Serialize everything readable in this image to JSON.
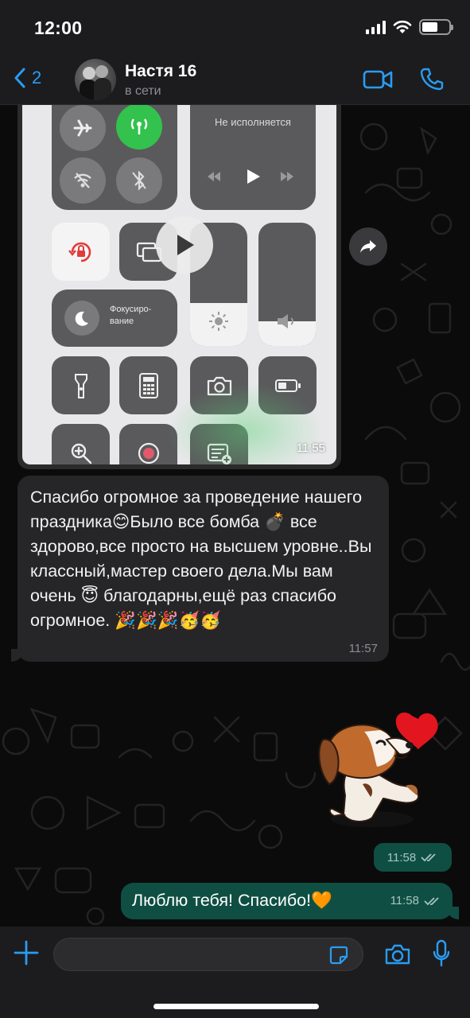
{
  "status_bar": {
    "time": "12:00"
  },
  "header": {
    "back_count": "2",
    "contact_name": "Настя 16",
    "contact_status": "в сети",
    "icons": [
      "chevron-left-icon",
      "video-call-icon",
      "phone-icon"
    ]
  },
  "messages": {
    "image_message": {
      "now_playing_label": "Не исполняется",
      "focus_label": "Фокусиро-\nвание",
      "time": "11:55",
      "brightness_level": 0.35,
      "volume_level": 0.2
    },
    "incoming_text": {
      "text": "Спасибо огромное за проведение нашего праздника😊Было все бомба 💣 все здорово,все просто на высшем уровне..Вы классный,мастер своего дела.Мы вам очень 😇 благодарны,ещё раз спасибо огромное. 🎉🎉🎉🥳🥳",
      "time": "11:57"
    },
    "sticker_message": {
      "time": "11:58"
    },
    "outgoing_text": {
      "text": "Люблю тебя! Спасибо!🧡",
      "time": "11:58"
    }
  },
  "composer": {
    "placeholder": "",
    "icons": [
      "plus-icon",
      "sticker-icon",
      "camera-icon",
      "microphone-icon"
    ]
  },
  "colors": {
    "accent": "#2a9cf2",
    "outgoing_bubble": "#0f4f43",
    "incoming_bubble": "#262628",
    "bars": "#1c1c1e"
  }
}
